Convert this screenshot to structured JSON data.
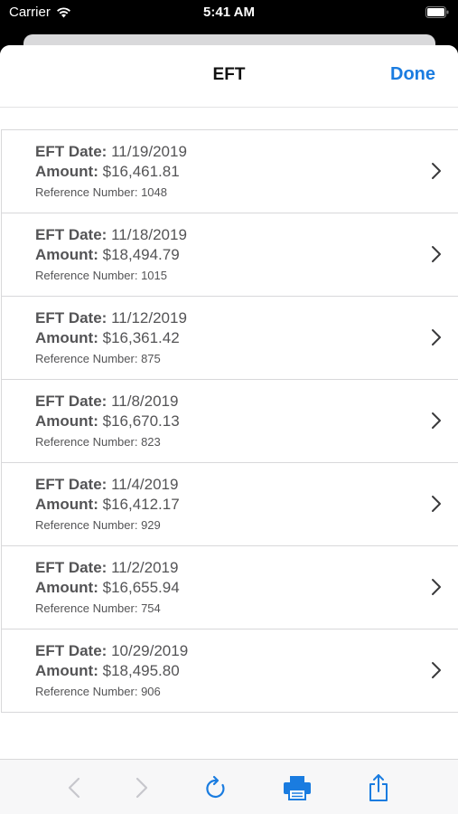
{
  "status_bar": {
    "carrier": "Carrier",
    "time": "5:41 AM"
  },
  "nav": {
    "title": "EFT",
    "done_label": "Done"
  },
  "labels": {
    "date_label": "EFT Date:",
    "amount_label": "Amount:",
    "ref_label": "Reference Number:"
  },
  "rows": [
    {
      "date": "11/19/2019",
      "amount": "$16,461.81",
      "ref": "1048"
    },
    {
      "date": "11/18/2019",
      "amount": "$18,494.79",
      "ref": "1015"
    },
    {
      "date": "11/12/2019",
      "amount": "$16,361.42",
      "ref": "875"
    },
    {
      "date": "11/8/2019",
      "amount": "$16,670.13",
      "ref": "823"
    },
    {
      "date": "11/4/2019",
      "amount": "$16,412.17",
      "ref": "929"
    },
    {
      "date": "11/2/2019",
      "amount": "$16,655.94",
      "ref": "754"
    },
    {
      "date": "10/29/2019",
      "amount": "$18,495.80",
      "ref": "906"
    }
  ],
  "toolbar": {
    "icons": [
      "back-arrow-icon",
      "forward-arrow-icon",
      "refresh-icon",
      "print-icon",
      "share-icon"
    ]
  },
  "colors": {
    "accent": "#1a7ce0",
    "disabled": "#c7c7cc",
    "text": "#545456"
  }
}
